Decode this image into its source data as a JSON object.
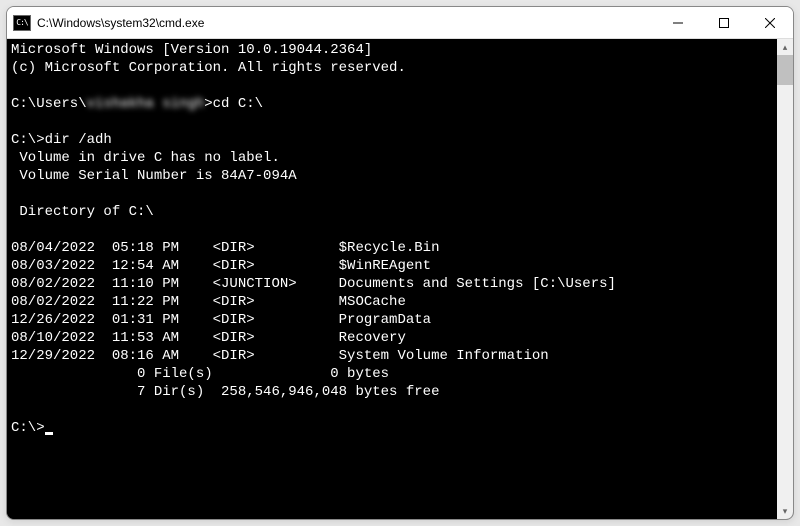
{
  "window": {
    "title": "C:\\Windows\\system32\\cmd.exe"
  },
  "terminal": {
    "banner_line1": "Microsoft Windows [Version 10.0.19044.2364]",
    "banner_line2": "(c) Microsoft Corporation. All rights reserved.",
    "prompt1_prefix": "C:\\Users\\",
    "prompt1_user_blurred": "vishakha singh",
    "prompt1_suffix": ">cd C:\\",
    "prompt2": "C:\\>dir /adh",
    "volume_line": " Volume in drive C has no label.",
    "serial_line": " Volume Serial Number is 84A7-094A",
    "directory_of": " Directory of C:\\",
    "entries": [
      {
        "date": "08/04/2022",
        "time": "05:18 PM",
        "type": "<DIR>     ",
        "name": "$Recycle.Bin"
      },
      {
        "date": "08/03/2022",
        "time": "12:54 AM",
        "type": "<DIR>     ",
        "name": "$WinREAgent"
      },
      {
        "date": "08/02/2022",
        "time": "11:10 PM",
        "type": "<JUNCTION>",
        "name": "Documents and Settings [C:\\Users]"
      },
      {
        "date": "08/02/2022",
        "time": "11:22 PM",
        "type": "<DIR>     ",
        "name": "MSOCache"
      },
      {
        "date": "12/26/2022",
        "time": "01:31 PM",
        "type": "<DIR>     ",
        "name": "ProgramData"
      },
      {
        "date": "08/10/2022",
        "time": "11:53 AM",
        "type": "<DIR>     ",
        "name": "Recovery"
      },
      {
        "date": "12/29/2022",
        "time": "08:16 AM",
        "type": "<DIR>     ",
        "name": "System Volume Information"
      }
    ],
    "summary_files": "               0 File(s)              0 bytes",
    "summary_dirs": "               7 Dir(s)  258,546,946,048 bytes free",
    "prompt3": "C:\\>"
  }
}
